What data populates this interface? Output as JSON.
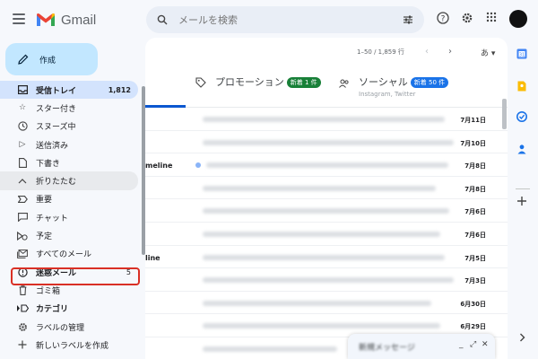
{
  "app": {
    "logo_text": "Gmail"
  },
  "search": {
    "placeholder": "メールを検索"
  },
  "compose": {
    "label": "作成"
  },
  "sidebar": {
    "items": [
      {
        "label": "受信トレイ",
        "count": "1,812",
        "icon": "inbox-icon"
      },
      {
        "label": "スター付き",
        "count": "",
        "icon": "star-icon"
      },
      {
        "label": "スヌーズ中",
        "count": "",
        "icon": "clock-icon"
      },
      {
        "label": "送信済み",
        "count": "",
        "icon": "send-icon"
      },
      {
        "label": "下書き",
        "count": "",
        "icon": "draft-icon"
      },
      {
        "label": "折りたたむ",
        "count": "",
        "icon": "chevron-up-icon"
      },
      {
        "label": "重要",
        "count": "",
        "icon": "important-icon"
      },
      {
        "label": "チャット",
        "count": "",
        "icon": "chat-icon"
      },
      {
        "label": "予定",
        "count": "",
        "icon": "scheduled-icon"
      },
      {
        "label": "すべてのメール",
        "count": "",
        "icon": "all-mail-icon"
      },
      {
        "label": "迷惑メール",
        "count": "5",
        "icon": "spam-icon"
      },
      {
        "label": "ゴミ箱",
        "count": "",
        "icon": "trash-icon"
      },
      {
        "label": "カテゴリ",
        "count": "",
        "icon": "label-icon"
      },
      {
        "label": "ラベルの管理",
        "count": "",
        "icon": "gear-icon"
      },
      {
        "label": "新しいラベルを作成",
        "count": "",
        "icon": "plus-icon"
      }
    ]
  },
  "toolbar": {
    "pager": "1–50 / 1,859 行",
    "lang": "あ"
  },
  "tabs": {
    "promotions": {
      "label": "プロモーション",
      "badge": "新着 1 件",
      "sub": ""
    },
    "social": {
      "label": "ソーシャル",
      "badge": "新着 50 件",
      "sub": "Instagram, Twitter"
    }
  },
  "emails": [
    {
      "sender": "",
      "date": "7月11日"
    },
    {
      "sender": "",
      "date": "7月10日"
    },
    {
      "sender": "meline",
      "date": "7月8日"
    },
    {
      "sender": "",
      "date": "7月8日"
    },
    {
      "sender": "",
      "date": "7月6日"
    },
    {
      "sender": "",
      "date": "7月6日"
    },
    {
      "sender": "line",
      "date": "7月5日"
    },
    {
      "sender": "",
      "date": "7月3日"
    },
    {
      "sender": "",
      "date": "6月30日"
    },
    {
      "sender": "",
      "date": "6月29日"
    },
    {
      "sender": "",
      "date": ""
    }
  ],
  "draft": {
    "title": "新規メッセージ"
  },
  "colors": {
    "accent": "#0b57d0",
    "compose_bg": "#c2e7ff",
    "inbox_active": "#d3e3fd",
    "promo_badge": "#188038",
    "social_badge": "#1a73e8",
    "highlight": "#d93025"
  }
}
